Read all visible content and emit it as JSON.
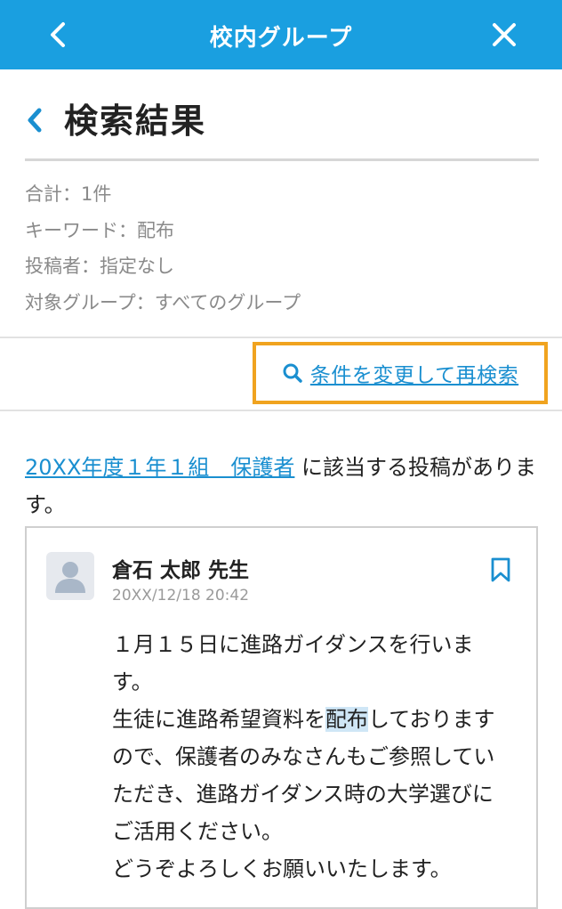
{
  "header": {
    "title": "校内グループ"
  },
  "page": {
    "title": "検索結果"
  },
  "summary": {
    "total": "合計：1件",
    "keyword": "キーワード：配布",
    "poster": "投稿者：指定なし",
    "target_group": "対象グループ：すべてのグループ"
  },
  "research_link": "条件を変更して再検索",
  "intro": {
    "group_link": "20XX年度１年１組　保護者",
    "text": " に該当する投稿があります。"
  },
  "post": {
    "author": "倉石 太郎 先生",
    "date": "20XX/12/18 20:42",
    "body_1": "１月１５日に進路ガイダンスを行います。",
    "body_2a": "生徒に進路希望資料を",
    "body_2_highlight": "配布",
    "body_2b": "しておりますので、保護者のみなさんもご参照していただき、進路ガイダンス時の大学選びにご活用ください。",
    "body_3": "どうぞよろしくお願いいたします。"
  },
  "colors": {
    "header_bg": "#1a9fe0",
    "link": "#1a8fd0",
    "focus_border": "#f0a31f",
    "highlight": "#cfe6f6"
  },
  "icons": {
    "back": "chevron-left-icon",
    "close": "close-icon",
    "search": "search-icon",
    "bookmark": "bookmark-icon",
    "avatar": "user-avatar-icon"
  }
}
